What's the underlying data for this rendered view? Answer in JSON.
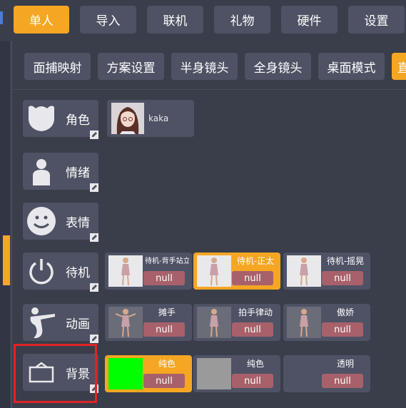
{
  "top_tabs": [
    {
      "label": "单人",
      "active": true
    },
    {
      "label": "导入",
      "active": false
    },
    {
      "label": "联机",
      "active": false
    },
    {
      "label": "礼物",
      "active": false
    },
    {
      "label": "硬件",
      "active": false
    },
    {
      "label": "设置",
      "active": false
    }
  ],
  "sub_tabs": [
    {
      "label": "面捕映射"
    },
    {
      "label": "方案设置"
    },
    {
      "label": "半身镜头"
    },
    {
      "label": "全身镜头"
    },
    {
      "label": "桌面模式"
    },
    {
      "label": "直"
    }
  ],
  "categories": [
    {
      "label": "角色",
      "icon": "character-face-icon"
    },
    {
      "label": "情绪",
      "icon": "person-icon"
    },
    {
      "label": "表情",
      "icon": "smiley-icon"
    },
    {
      "label": "待机",
      "icon": "power-icon"
    },
    {
      "label": "动画",
      "icon": "dance-pose-icon"
    },
    {
      "label": "背景",
      "icon": "background-frame-icon"
    }
  ],
  "character": {
    "name": "kaka"
  },
  "idle_items": [
    {
      "name": "待机-背手站立",
      "value": "null",
      "selected": false
    },
    {
      "name": "待机-正太",
      "value": "null",
      "selected": true
    },
    {
      "name": "待机-摇晃",
      "value": "null",
      "selected": false
    }
  ],
  "animation_items": [
    {
      "name": "摊手",
      "value": "null"
    },
    {
      "name": "拍手律动",
      "value": "null"
    },
    {
      "name": "傲娇",
      "value": "null"
    }
  ],
  "background_items": [
    {
      "name": "纯色",
      "value": "null",
      "swatch": "#00ff00",
      "selected": true
    },
    {
      "name": "纯色",
      "value": "null",
      "swatch": "#9a9a9a",
      "selected": false
    },
    {
      "name": "透明",
      "value": "null",
      "swatch": "",
      "selected": false
    }
  ],
  "colors": {
    "accent": "#f5a623",
    "panel": "#4e5264",
    "badge": "#a8616a",
    "highlight": "#e02424"
  }
}
